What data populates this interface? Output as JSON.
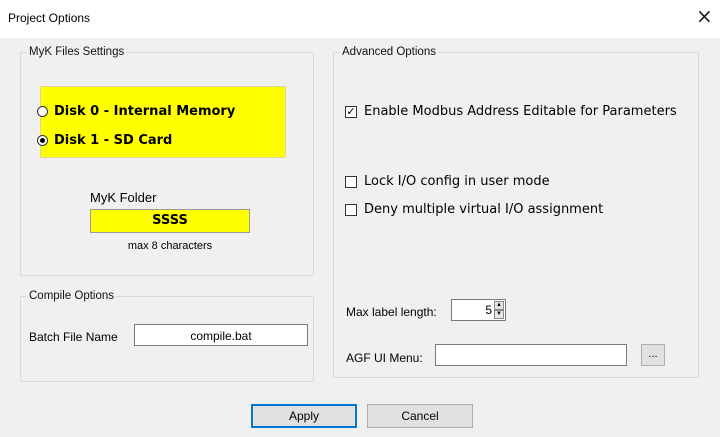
{
  "window": {
    "title": "Project Options",
    "close_glyph": "×"
  },
  "myk_files": {
    "legend": "MyK Files Settings",
    "highlight_color": "#ffff00",
    "disk_options": [
      {
        "label": "Disk 0 - Internal Memory",
        "selected": false
      },
      {
        "label": "Disk 1 - SD Card",
        "selected": true
      }
    ],
    "folder_label": "MyK Folder",
    "folder_value": "SSSS",
    "folder_hint": "max 8 characters"
  },
  "compile_options": {
    "legend": "Compile Options",
    "batch_label": "Batch File Name",
    "batch_value": "compile.bat"
  },
  "advanced": {
    "legend": "Advanced Options",
    "checks": [
      {
        "label": "Enable Modbus Address Editable for Parameters",
        "checked": true
      },
      {
        "label": "Lock I/O config in user mode",
        "checked": false
      },
      {
        "label": "Deny multiple virtual I/O assignment",
        "checked": false
      }
    ],
    "max_label_text": "Max label length:",
    "max_label_value": "5",
    "agf_label": "AGF UI Menu:",
    "agf_value": "",
    "browse_label": "..."
  },
  "buttons": {
    "apply": "Apply",
    "cancel": "Cancel"
  }
}
